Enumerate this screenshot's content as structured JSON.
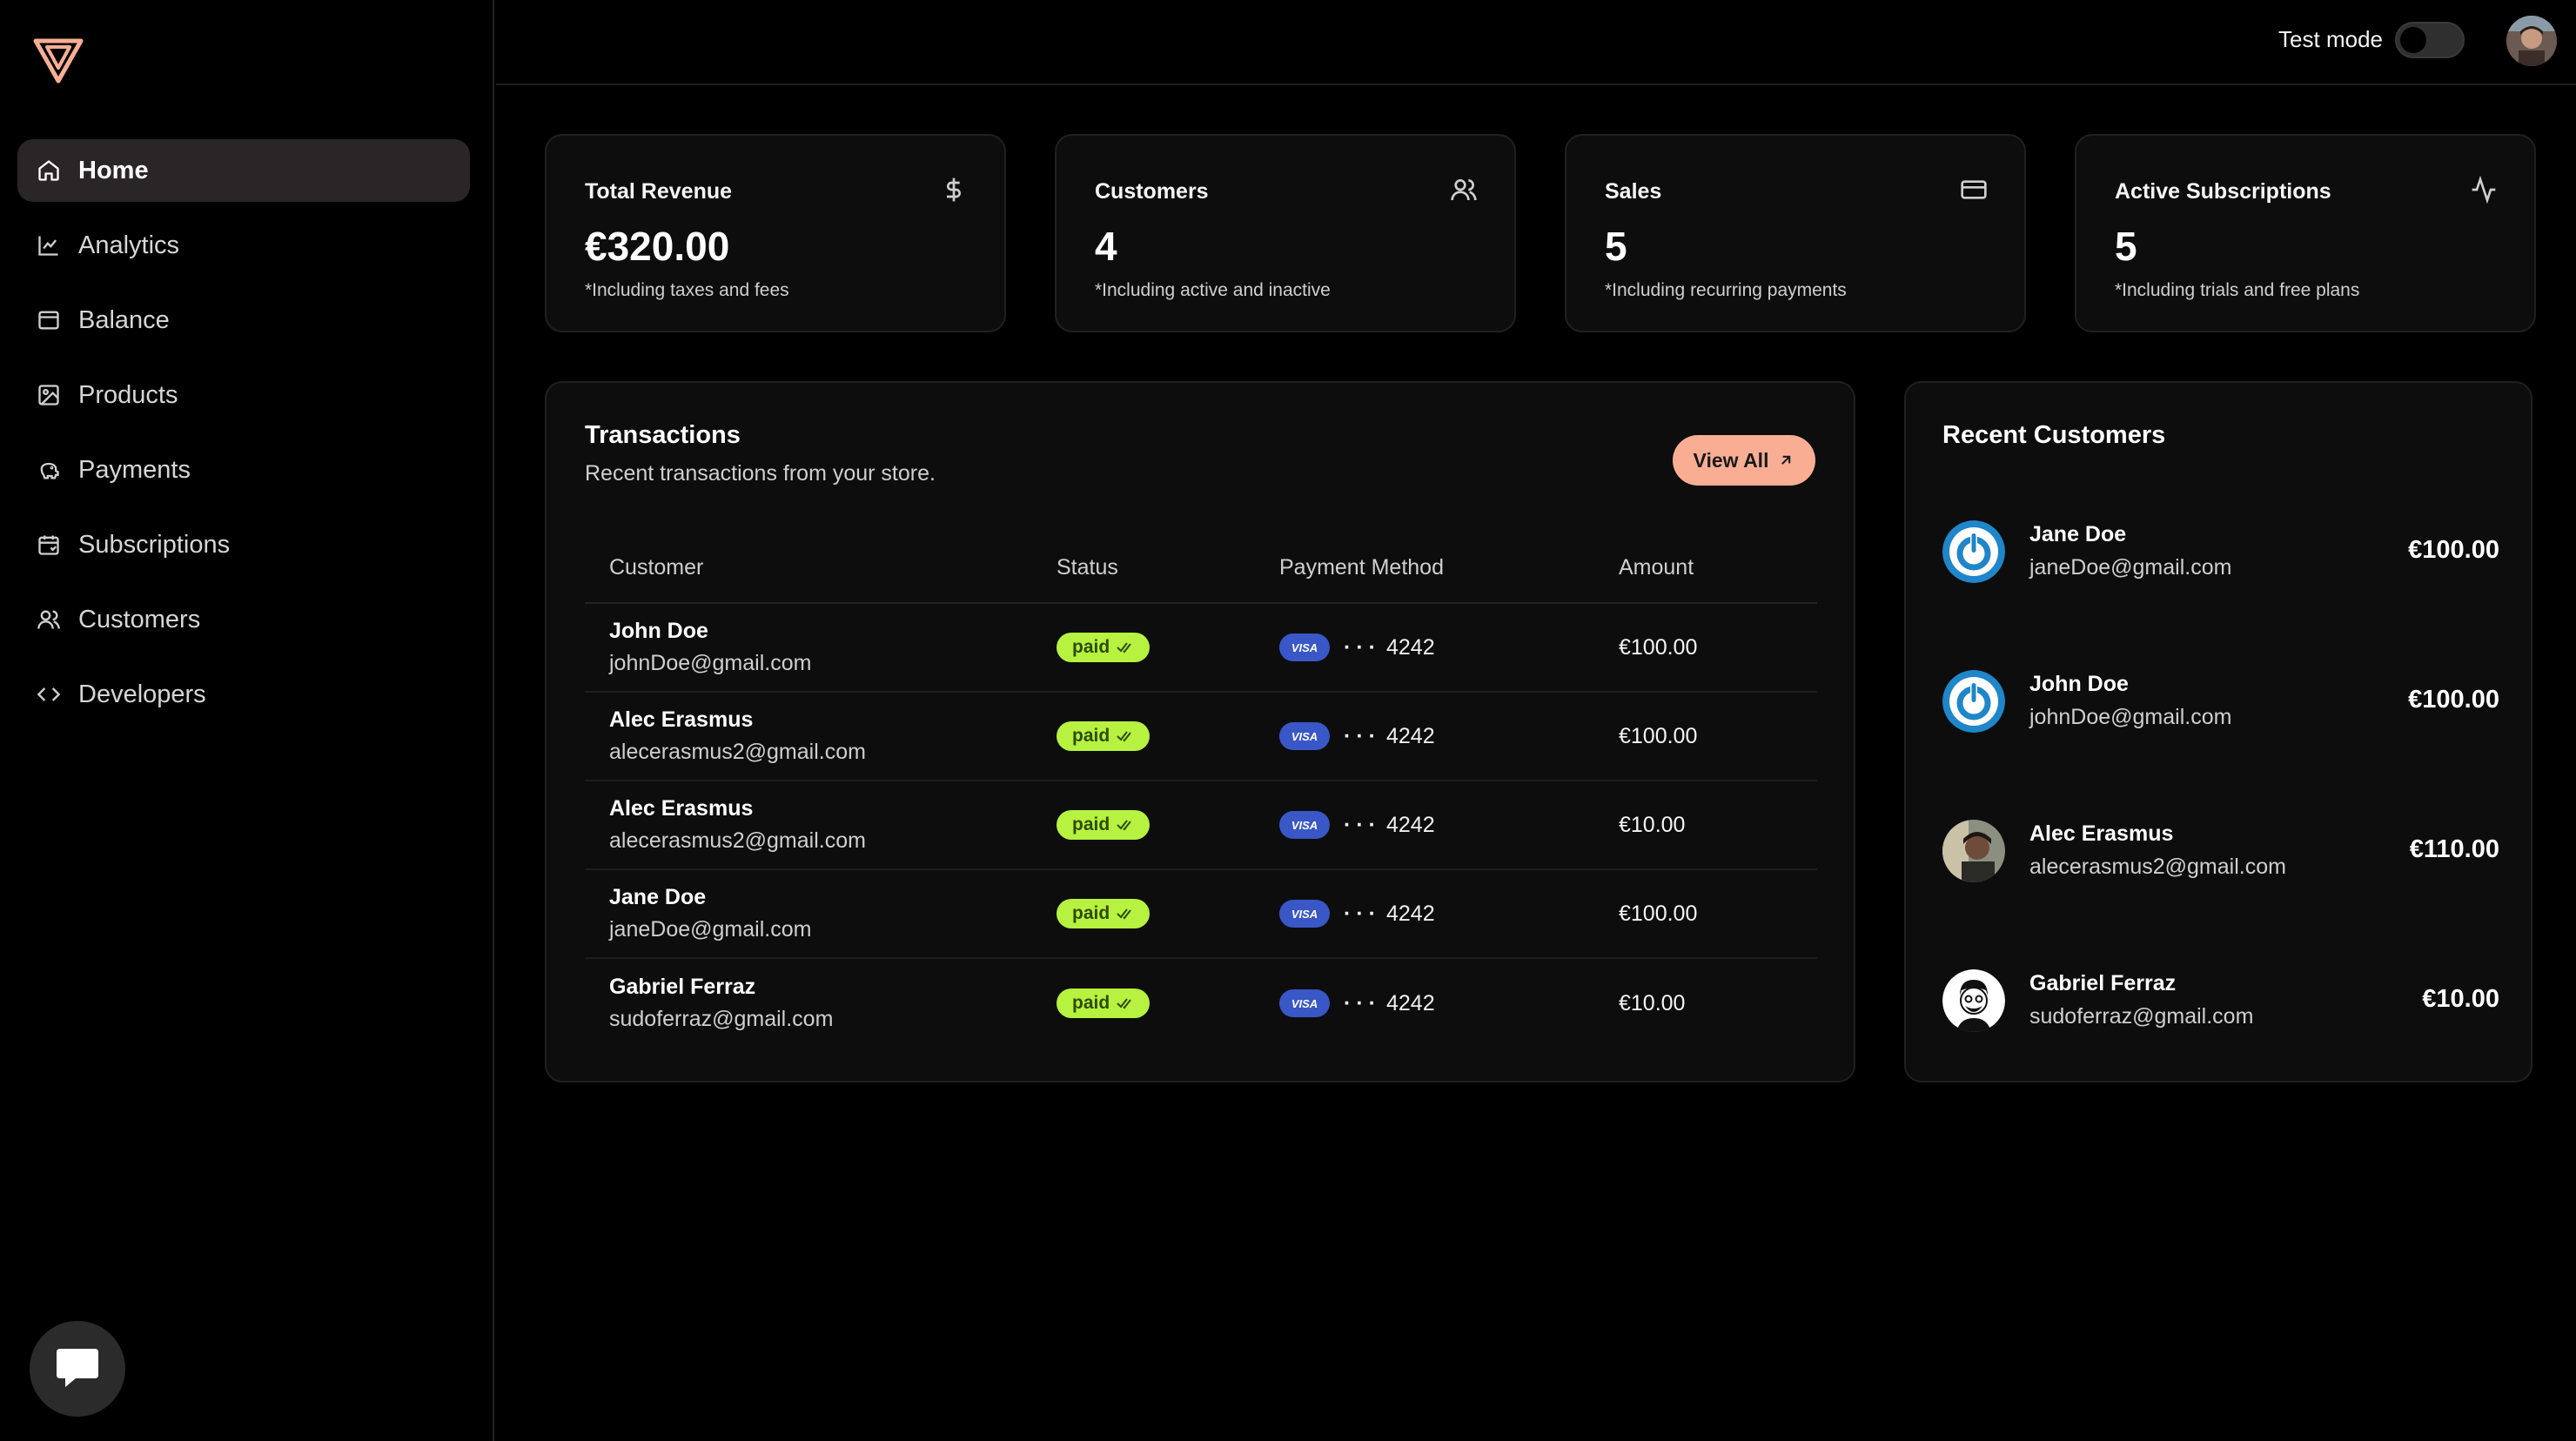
{
  "topbar": {
    "test_mode_label": "Test mode"
  },
  "sidebar": {
    "items": [
      {
        "label": "Home",
        "icon": "home-icon",
        "active": true
      },
      {
        "label": "Analytics",
        "icon": "chart-line-icon"
      },
      {
        "label": "Balance",
        "icon": "wallet-icon"
      },
      {
        "label": "Products",
        "icon": "image-icon"
      },
      {
        "label": "Payments",
        "icon": "piggy-bank-icon"
      },
      {
        "label": "Subscriptions",
        "icon": "calendar-icon"
      },
      {
        "label": "Customers",
        "icon": "users-icon"
      },
      {
        "label": "Developers",
        "icon": "code-icon"
      }
    ]
  },
  "stats": [
    {
      "title": "Total Revenue",
      "value": "€320.00",
      "note": "*Including taxes and fees",
      "icon": "dollar-icon"
    },
    {
      "title": "Customers",
      "value": "4",
      "note": "*Including active and inactive",
      "icon": "users-icon"
    },
    {
      "title": "Sales",
      "value": "5",
      "note": "*Including recurring payments",
      "icon": "credit-card-icon"
    },
    {
      "title": "Active Subscriptions",
      "value": "5",
      "note": "*Including trials and free plans",
      "icon": "activity-icon"
    }
  ],
  "transactions": {
    "title": "Transactions",
    "subtitle": "Recent transactions from your store.",
    "view_all_label": "View All",
    "columns": [
      "Customer",
      "Status",
      "Payment Method",
      "Amount"
    ],
    "rows": [
      {
        "name": "John Doe",
        "email": "johnDoe@gmail.com",
        "status": "paid",
        "card_brand": "VISA",
        "dots": "···",
        "last4": "4242",
        "amount": "€100.00"
      },
      {
        "name": "Alec Erasmus",
        "email": "alecerasmus2@gmail.com",
        "status": "paid",
        "card_brand": "VISA",
        "dots": "···",
        "last4": "4242",
        "amount": "€100.00"
      },
      {
        "name": "Alec Erasmus",
        "email": "alecerasmus2@gmail.com",
        "status": "paid",
        "card_brand": "VISA",
        "dots": "···",
        "last4": "4242",
        "amount": "€10.00"
      },
      {
        "name": "Jane Doe",
        "email": "janeDoe@gmail.com",
        "status": "paid",
        "card_brand": "VISA",
        "dots": "···",
        "last4": "4242",
        "amount": "€100.00"
      },
      {
        "name": "Gabriel Ferraz",
        "email": "sudoferraz@gmail.com",
        "status": "paid",
        "card_brand": "VISA",
        "dots": "···",
        "last4": "4242",
        "amount": "€10.00"
      }
    ]
  },
  "recent_customers": {
    "title": "Recent Customers",
    "items": [
      {
        "name": "Jane Doe",
        "email": "janeDoe@gmail.com",
        "amount": "€100.00",
        "avatar": "power-logo"
      },
      {
        "name": "John Doe",
        "email": "johnDoe@gmail.com",
        "amount": "€100.00",
        "avatar": "power-logo"
      },
      {
        "name": "Alec Erasmus",
        "email": "alecerasmus2@gmail.com",
        "amount": "€110.00",
        "avatar": "photo"
      },
      {
        "name": "Gabriel Ferraz",
        "email": "sudoferraz@gmail.com",
        "amount": "€10.00",
        "avatar": "illustration"
      }
    ]
  },
  "colors": {
    "accent": "#f9ae94",
    "paid_badge": "#b6f23f",
    "visa": "#3957c6",
    "panel": "#0d0d0d"
  }
}
